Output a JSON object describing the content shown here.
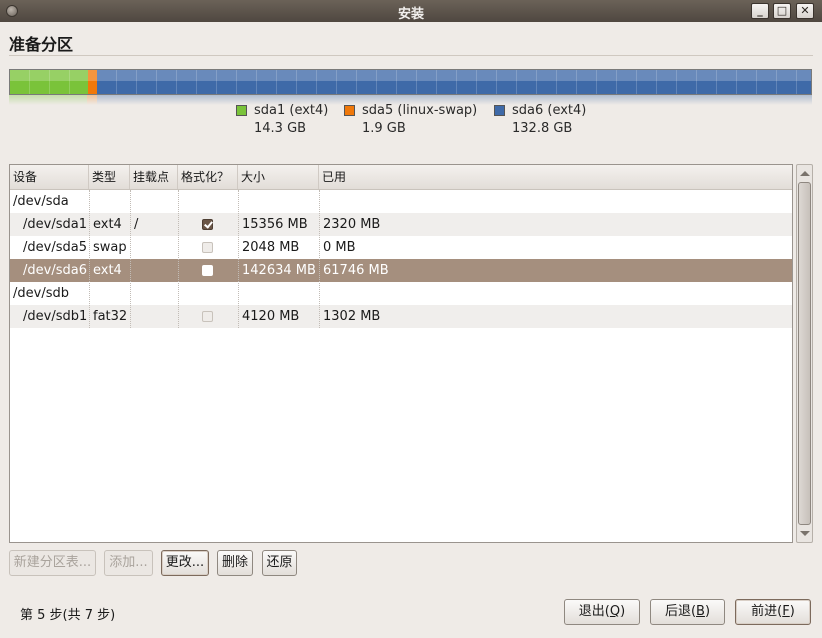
{
  "window": {
    "title": "安装",
    "controls": {
      "minimize": "_",
      "maximize": "□",
      "close": "✕"
    }
  },
  "page": {
    "title": "准备分区"
  },
  "partition_bar": {
    "segments": [
      {
        "name": "sda1 (ext4)",
        "size": "14.3 GB",
        "fraction": 0.097,
        "color": "#7ac33a"
      },
      {
        "name": "sda5 (linux-swap)",
        "size": "1.9 GB",
        "fraction": 0.012,
        "color": "#f0780a"
      },
      {
        "name": "sda6 (ext4)",
        "size": "132.8 GB",
        "fraction": 0.891,
        "color": "#3f6aa8"
      }
    ]
  },
  "table": {
    "columns": [
      "设备",
      "类型",
      "挂载点",
      "格式化？",
      "大小",
      "已用"
    ],
    "rows": [
      {
        "device": "/dev/sda",
        "type": "",
        "mount": "",
        "format": null,
        "size": "",
        "used": "",
        "indent": false,
        "selected": false
      },
      {
        "device": "/dev/sda1",
        "type": "ext4",
        "mount": "/",
        "format": "checked",
        "size": "15356 MB",
        "used": "2320 MB",
        "indent": true,
        "selected": false
      },
      {
        "device": "/dev/sda5",
        "type": "swap",
        "mount": "",
        "format": "unchecked",
        "size": "2048 MB",
        "used": "0 MB",
        "indent": true,
        "selected": false
      },
      {
        "device": "/dev/sda6",
        "type": "ext4",
        "mount": "",
        "format": "unchecked",
        "size": "142634 MB",
        "used": "61746 MB",
        "indent": true,
        "selected": true
      },
      {
        "device": "/dev/sdb",
        "type": "",
        "mount": "",
        "format": null,
        "size": "",
        "used": "",
        "indent": false,
        "selected": false
      },
      {
        "device": "/dev/sdb1",
        "type": "fat32",
        "mount": "",
        "format": "unchecked",
        "size": "4120 MB",
        "used": "1302 MB",
        "indent": true,
        "selected": false
      }
    ]
  },
  "actions": {
    "new_table": "新建分区表...",
    "add": "添加...",
    "change": "更改...",
    "delete": "删除",
    "revert": "还原"
  },
  "footer": {
    "step": "第 5 步(共 7 步)",
    "quit": {
      "text": "退出(",
      "key": "Q",
      "end": ")"
    },
    "back": {
      "text": "后退(",
      "key": "B",
      "end": ")"
    },
    "forward": {
      "text": "前进(",
      "key": "F",
      "end": ")"
    }
  }
}
